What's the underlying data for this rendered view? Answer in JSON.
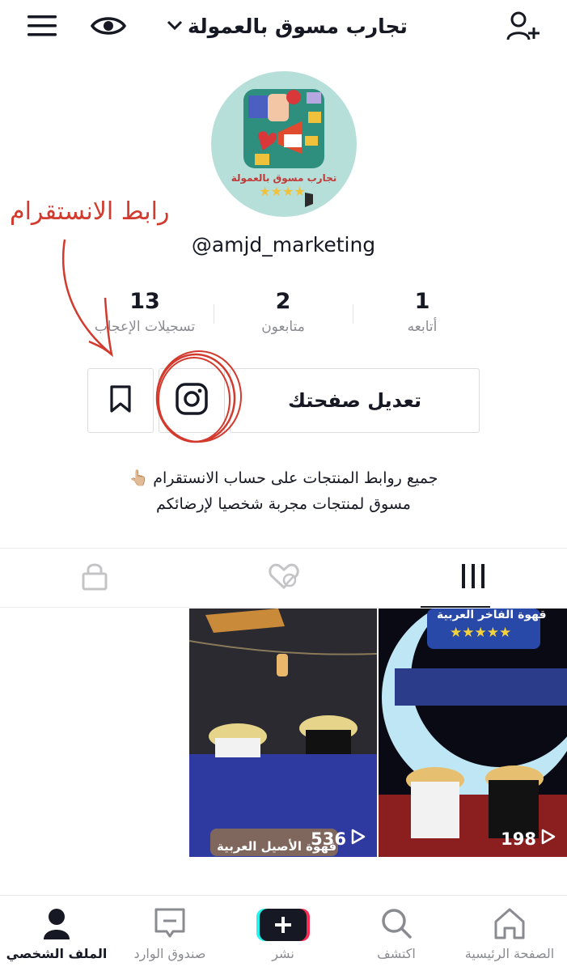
{
  "header": {
    "title": "تجارب مسوق بالعمولة",
    "menu_icon": "hamburger-icon",
    "eye_icon": "eye-icon",
    "chevron_icon": "chevron-down-icon",
    "add_user_icon": "add-user-icon"
  },
  "profile": {
    "avatar_text": "تجارب مسوق بالعمولة",
    "username": "@amjd_marketing",
    "annotation": "رابط الانستقرام"
  },
  "stats": [
    {
      "value": "13",
      "label": "تسجيلات الإعجاب"
    },
    {
      "value": "2",
      "label": "متابعون"
    },
    {
      "value": "1",
      "label": "أتابعه"
    }
  ],
  "actions": {
    "edit_label": "تعديل صفحتك",
    "instagram_icon": "instagram-icon",
    "bookmark_icon": "bookmark-icon"
  },
  "bio": {
    "line1": "جميع روابط المنتجات على حساب الانستقرام 👆🏼",
    "line2": "مسوق لمنتجات مجربة شخصيا لإرضائكم"
  },
  "tabs": [
    "grid-icon",
    "liked-hidden-icon",
    "lock-icon"
  ],
  "videos": [
    {
      "views": "536",
      "caption": "قهوة الأصيل العربية"
    },
    {
      "views": "198",
      "caption": "قهوة الفاخر العربية",
      "rating": "★★★★★"
    }
  ],
  "bottom_nav": [
    {
      "label": "الصفحة الرئيسية",
      "icon": "home-icon"
    },
    {
      "label": "اكتشف",
      "icon": "search-icon"
    },
    {
      "label": "نشر",
      "icon": "plus-icon"
    },
    {
      "label": "صندوق الوارد",
      "icon": "inbox-icon"
    },
    {
      "label": "الملف الشخصي",
      "icon": "profile-icon"
    }
  ],
  "colors": {
    "text": "#161823",
    "muted": "#8a8b91",
    "annotation": "#d23a2e",
    "tiktok_cyan": "#25f4ee",
    "tiktok_red": "#fe2c55"
  }
}
